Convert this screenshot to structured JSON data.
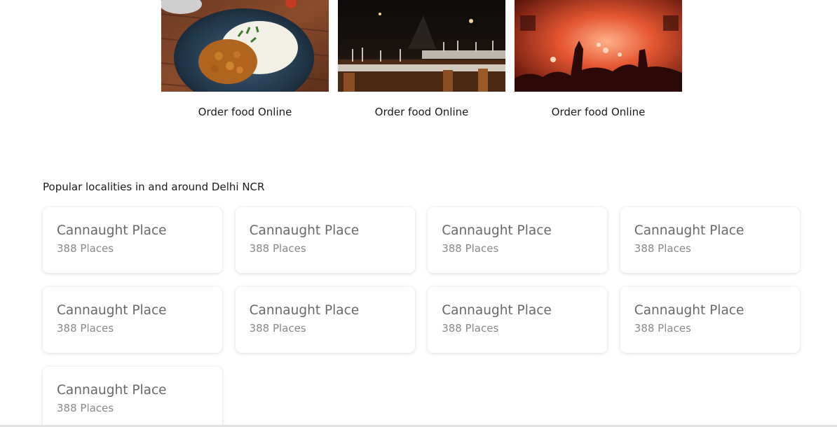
{
  "collections": [
    {
      "label": "Order food Online",
      "image": "curry-rice-plate-photo"
    },
    {
      "label": "Order food Online",
      "image": "restaurant-dining-interior-photo"
    },
    {
      "label": "Order food Online",
      "image": "nightlife-concert-crowd-photo"
    }
  ],
  "localities_section": {
    "title": "Popular localities in and around Delhi NCR"
  },
  "localities": [
    {
      "name": "Cannaught Place",
      "count": "388 Places"
    },
    {
      "name": "Cannaught Place",
      "count": "388 Places"
    },
    {
      "name": "Cannaught Place",
      "count": "388 Places"
    },
    {
      "name": "Cannaught Place",
      "count": "388 Places"
    },
    {
      "name": "Cannaught Place",
      "count": "388 Places"
    },
    {
      "name": "Cannaught Place",
      "count": "388 Places"
    },
    {
      "name": "Cannaught Place",
      "count": "388 Places"
    },
    {
      "name": "Cannaught Place",
      "count": "388 Places"
    },
    {
      "name": "Cannaught Place",
      "count": "388 Places"
    }
  ],
  "colors": {
    "text_primary": "#1c1c1c",
    "locality_name": "#696969",
    "locality_count": "#8a8a8a"
  }
}
